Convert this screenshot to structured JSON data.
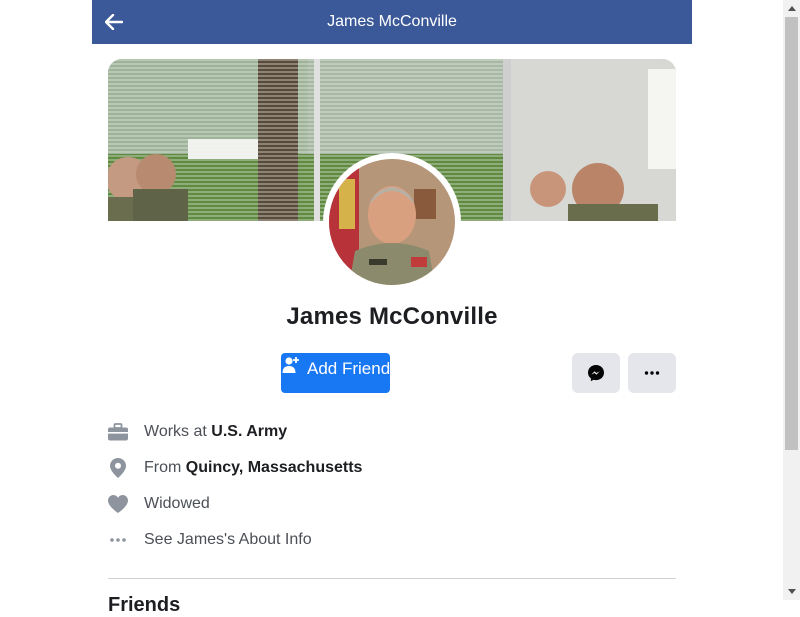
{
  "header": {
    "title": "James McConville",
    "back_icon": "arrow-left-icon",
    "bg_color": "#3b5998"
  },
  "profile": {
    "name": "James McConville"
  },
  "actions": {
    "add_friend_label": "Add Friend",
    "add_friend_color": "#1877f2",
    "messenger_icon": "messenger-icon",
    "more_icon": "ellipsis-icon"
  },
  "info": {
    "work_prefix": "Works at ",
    "work_value": "U.S. Army",
    "from_prefix": "From ",
    "from_value": "Quincy, Massachusetts",
    "relationship": "Widowed",
    "about_link": "See James's About Info"
  },
  "friends": {
    "title": "Friends"
  }
}
